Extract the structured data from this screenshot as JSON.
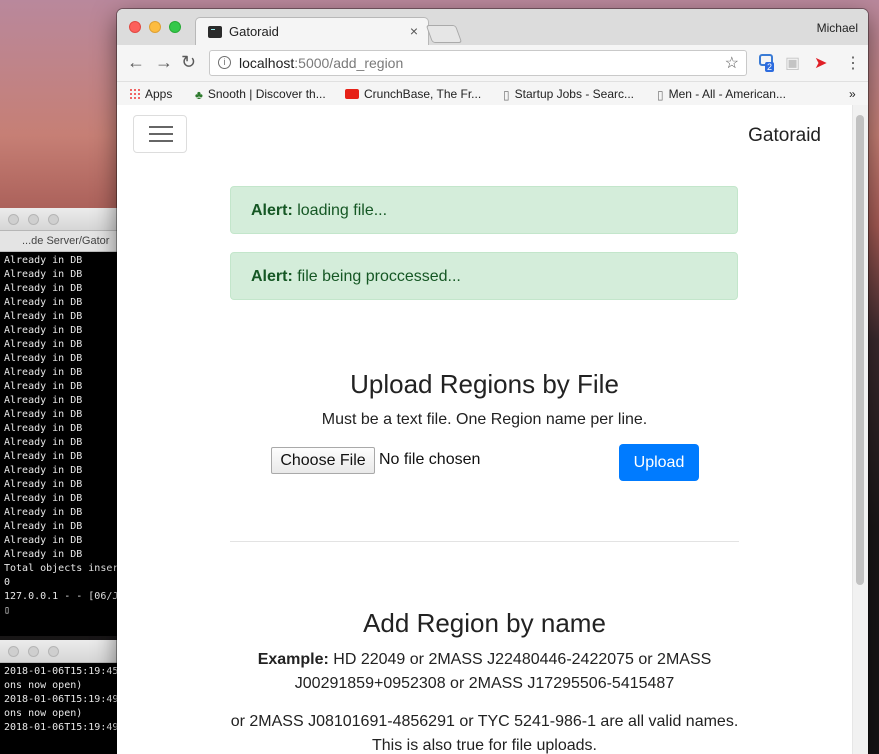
{
  "terminal_top": {
    "tab_title": "...de Server/Gator",
    "lines": [
      "Already in DB",
      "Already in DB",
      "Already in DB",
      "Already in DB",
      "Already in DB",
      "Already in DB",
      "Already in DB",
      "Already in DB",
      "Already in DB",
      "Already in DB",
      "Already in DB",
      "Already in DB",
      "Already in DB",
      "Already in DB",
      "Already in DB",
      "Already in DB",
      "Already in DB",
      "Already in DB",
      "Already in DB",
      "Already in DB",
      "Already in DB",
      "Already in DB",
      "Total objects inser",
      "0",
      "127.0.0.1 - - [06/J",
      "▯"
    ]
  },
  "terminal_bottom": {
    "lines": [
      "2018-01-06T15:19:45",
      "ons now open)",
      "2018-01-06T15:19:49",
      "ons now open)",
      "2018-01-06T15:19:49"
    ]
  },
  "browser": {
    "tab_title": "Gatoraid",
    "tab_close": "×",
    "profile": "Michael",
    "url_host": "localhost",
    "url_rest": ":5000/add_region",
    "ext_badge": "2",
    "bookmarks": [
      {
        "label": "Apps"
      },
      {
        "label": "Snooth | Discover th..."
      },
      {
        "label": "CrunchBase, The Fr..."
      },
      {
        "label": "Startup Jobs - Searc..."
      },
      {
        "label": "Men - All - American..."
      }
    ],
    "bookmarks_more": "»"
  },
  "page": {
    "brand": "Gatoraid",
    "alerts": [
      {
        "strong": "Alert:",
        "text": " loading file..."
      },
      {
        "strong": "Alert:",
        "text": " file being proccessed..."
      }
    ],
    "upload_heading": "Upload Regions by File",
    "upload_sub": "Must be a text file. One Region name per line.",
    "choose_file": "Choose File",
    "no_file": "No file chosen",
    "upload_button": "Upload",
    "add_heading": "Add Region by name",
    "example_label": "Example:",
    "example_text": " HD 22049 or 2MASS J22480446-2422075 or 2MASS J00291859+0952308 or 2MASS J17295506-5415487",
    "para2": "or 2MASS J08101691-4856291 or TYC 5241-986-1 are all valid names. This is also true for file uploads."
  }
}
